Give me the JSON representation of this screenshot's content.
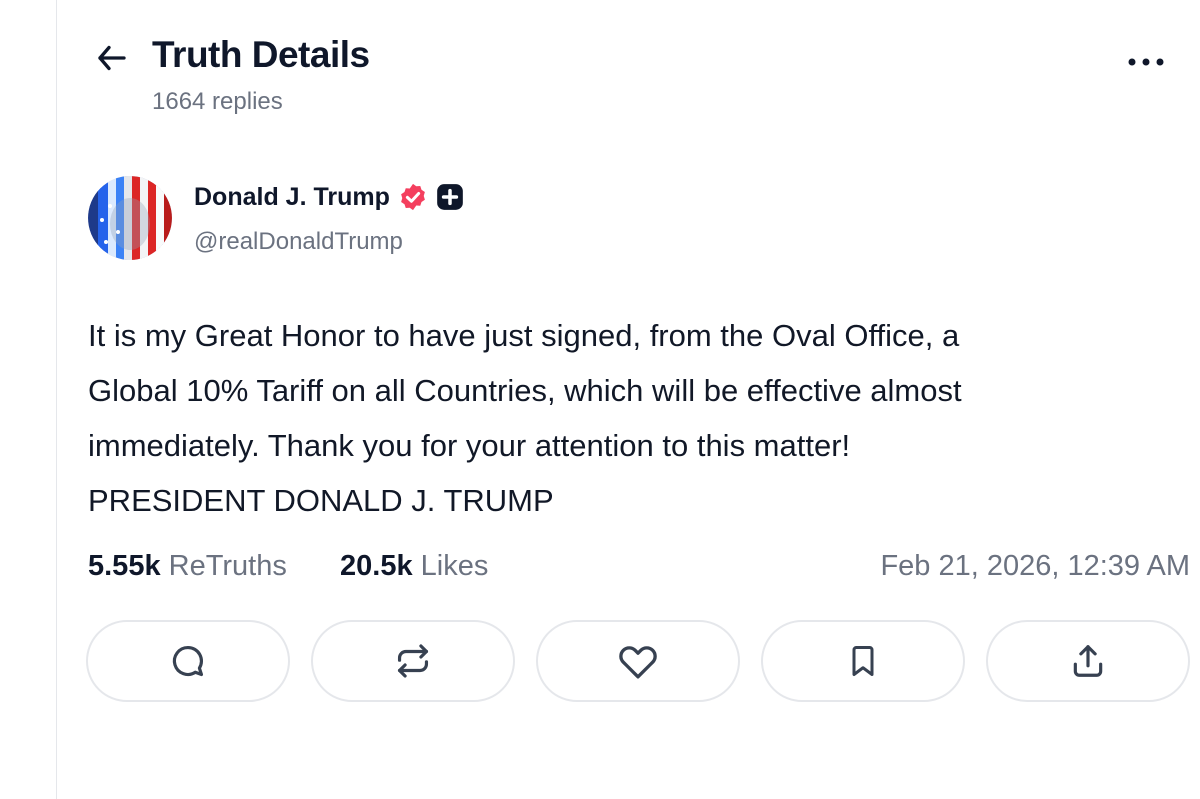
{
  "header": {
    "back_icon": "arrow-left-icon",
    "title": "Truth Details",
    "replies": "1664 replies",
    "more_icon": "more-horizontal-icon"
  },
  "author": {
    "name": "Donald J. Trump",
    "handle": "@realDonaldTrump",
    "verified_icon": "verified-badge-icon",
    "verified_color": "#f43f5e",
    "plus_icon": "plus-badge-icon"
  },
  "post": {
    "lines": [
      "It is my Great Honor to have just signed, from the Oval Office, a",
      "Global 10% Tariff on all Countries, which will be effective almost",
      "immediately. Thank you for your attention to this matter!",
      "PRESIDENT DONALD J. TRUMP"
    ]
  },
  "stats": {
    "retruths_count": "5.55k",
    "retruths_label": "ReTruths",
    "likes_count": "20.5k",
    "likes_label": "Likes",
    "timestamp": "Feb 21, 2026, 12:39 AM"
  },
  "actions": [
    {
      "icon": "reply-icon"
    },
    {
      "icon": "retruth-icon"
    },
    {
      "icon": "like-icon"
    },
    {
      "icon": "bookmark-icon"
    },
    {
      "icon": "share-icon"
    }
  ],
  "colors": {
    "text": "#0f172a",
    "muted": "#6b7280",
    "border": "#e5e7eb"
  }
}
